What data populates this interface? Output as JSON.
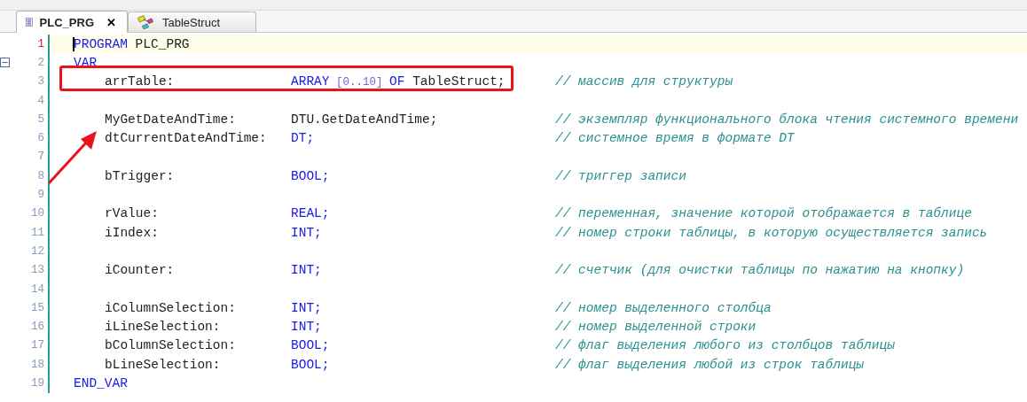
{
  "tabs": [
    {
      "label": "PLC_PRG",
      "selected": true,
      "kind": "program",
      "close": "✕"
    },
    {
      "label": "TableStruct",
      "selected": false,
      "kind": "struct"
    }
  ],
  "lines": [
    {
      "number": "1",
      "kind": "statement",
      "current": true,
      "highlighted": false,
      "tokens": [
        {
          "text": "PROGRAM",
          "kind": "keyword"
        },
        {
          "text": " PLC_PRG",
          "kind": "plain"
        }
      ]
    },
    {
      "number": "2",
      "kind": "statement",
      "current": false,
      "highlighted": false,
      "expanded": true,
      "tokens": [
        {
          "text": "VAR",
          "kind": "keyword"
        }
      ]
    },
    {
      "number": "3",
      "kind": "declaration",
      "current": false,
      "highlighted": true,
      "name": "arrTable:",
      "tokens": [
        {
          "text": "ARRAY",
          "kind": "keyword"
        },
        {
          "text": " [0..10] ",
          "kind": "number"
        },
        {
          "text": "OF",
          "kind": "keyword"
        },
        {
          "text": " TableStruct;",
          "kind": "plain"
        }
      ],
      "comment": "// массив для структуры"
    },
    {
      "number": "4",
      "kind": "blank",
      "current": false,
      "highlighted": false
    },
    {
      "number": "5",
      "kind": "declaration",
      "current": false,
      "highlighted": false,
      "name": "MyGetDateAndTime:",
      "tokens": [
        {
          "text": "DTU.GetDateAndTime;",
          "kind": "plain"
        }
      ],
      "comment": "// экземпляр функционального блока чтения системного времени"
    },
    {
      "number": "6",
      "kind": "declaration",
      "current": false,
      "highlighted": false,
      "name": "dtCurrentDateAndTime:",
      "tokens": [
        {
          "text": "DT;",
          "kind": "keyword"
        }
      ],
      "comment": "// системное время в формате DT"
    },
    {
      "number": "7",
      "kind": "blank",
      "current": false,
      "highlighted": false
    },
    {
      "number": "8",
      "kind": "declaration",
      "current": false,
      "highlighted": false,
      "name": "bTrigger:",
      "tokens": [
        {
          "text": "BOOL;",
          "kind": "keyword"
        }
      ],
      "comment": "// триггер записи"
    },
    {
      "number": "9",
      "kind": "blank",
      "current": false,
      "highlighted": false
    },
    {
      "number": "10",
      "kind": "declaration",
      "current": false,
      "highlighted": false,
      "name": "rValue:",
      "tokens": [
        {
          "text": "REAL;",
          "kind": "keyword"
        }
      ],
      "comment": "// переменная, значение которой отображается в таблице"
    },
    {
      "number": "11",
      "kind": "declaration",
      "current": false,
      "highlighted": false,
      "name": "iIndex:",
      "tokens": [
        {
          "text": "INT;",
          "kind": "keyword"
        }
      ],
      "comment": "// номер строки таблицы, в которую осуществляется запись"
    },
    {
      "number": "12",
      "kind": "blank",
      "current": false,
      "highlighted": false
    },
    {
      "number": "13",
      "kind": "declaration",
      "current": false,
      "highlighted": false,
      "name": "iCounter:",
      "tokens": [
        {
          "text": "INT;",
          "kind": "keyword"
        }
      ],
      "comment": "// счетчик (для очистки таблицы по нажатию на кнопку)"
    },
    {
      "number": "14",
      "kind": "blank",
      "current": false,
      "highlighted": false
    },
    {
      "number": "15",
      "kind": "declaration",
      "current": false,
      "highlighted": false,
      "name": "iColumnSelection:",
      "tokens": [
        {
          "text": "INT;",
          "kind": "keyword"
        }
      ],
      "comment": "// номер выделенного столбца"
    },
    {
      "number": "16",
      "kind": "declaration",
      "current": false,
      "highlighted": false,
      "name": "iLineSelection:",
      "tokens": [
        {
          "text": "INT;",
          "kind": "keyword"
        }
      ],
      "comment": "// номер выделенной строки"
    },
    {
      "number": "17",
      "kind": "declaration",
      "current": false,
      "highlighted": false,
      "name": "bColumnSelection:",
      "tokens": [
        {
          "text": "BOOL;",
          "kind": "keyword"
        }
      ],
      "comment": "// флаг выделения любого из столбцов таблицы"
    },
    {
      "number": "18",
      "kind": "declaration",
      "current": false,
      "highlighted": false,
      "name": "bLineSelection:",
      "tokens": [
        {
          "text": "BOOL;",
          "kind": "keyword"
        }
      ],
      "comment": "// флаг выделения любой из строк таблицы"
    },
    {
      "number": "19",
      "kind": "statement",
      "current": false,
      "highlighted": false,
      "tokens": [
        {
          "text": "END_VAR",
          "kind": "keyword"
        }
      ]
    }
  ]
}
